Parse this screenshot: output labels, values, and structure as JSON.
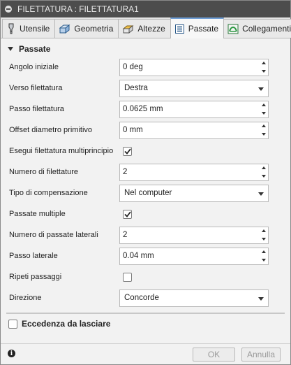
{
  "window": {
    "title": "FILETTATURA : FILETTATURA1"
  },
  "tabs": [
    {
      "label": "Utensile",
      "icon": "tool-icon"
    },
    {
      "label": "Geometria",
      "icon": "geometry-icon"
    },
    {
      "label": "Altezze",
      "icon": "heights-icon"
    },
    {
      "label": "Passate",
      "icon": "passes-icon",
      "active": true
    },
    {
      "label": "Collegamenti",
      "icon": "links-icon"
    }
  ],
  "section": {
    "title": "Passate"
  },
  "fields": {
    "angolo_iniziale": {
      "label": "Angolo iniziale",
      "value": "0 deg"
    },
    "verso_filettatura": {
      "label": "Verso filettatura",
      "value": "Destra"
    },
    "passo_filettatura": {
      "label": "Passo filettatura",
      "value": "0.0625 mm"
    },
    "offset_diametro": {
      "label": "Offset diametro primitivo",
      "value": "0 mm"
    },
    "multiprincipio": {
      "label": "Esegui filettatura multiprincipio",
      "checked": true
    },
    "numero_filettature": {
      "label": "Numero di filettature",
      "value": "2"
    },
    "tipo_compensazione": {
      "label": "Tipo di compensazione",
      "value": "Nel computer"
    },
    "passate_multiple": {
      "label": "Passate multiple",
      "checked": true
    },
    "numero_passate_laterali": {
      "label": "Numero di passate laterali",
      "value": "2"
    },
    "passo_laterale": {
      "label": "Passo laterale",
      "value": "0.04 mm"
    },
    "ripeti_passaggi": {
      "label": "Ripeti passaggi",
      "checked": false
    },
    "direzione": {
      "label": "Direzione",
      "value": "Concorde"
    }
  },
  "eccedenza": {
    "label": "Eccedenza da lasciare",
    "checked": false
  },
  "footer": {
    "ok_label": "OK",
    "cancel_label": "Annulla"
  },
  "colors": {
    "titlebar": "#4d4d4d",
    "active_tab_accent": "#6f9ed6",
    "check_mark": "#222222"
  }
}
